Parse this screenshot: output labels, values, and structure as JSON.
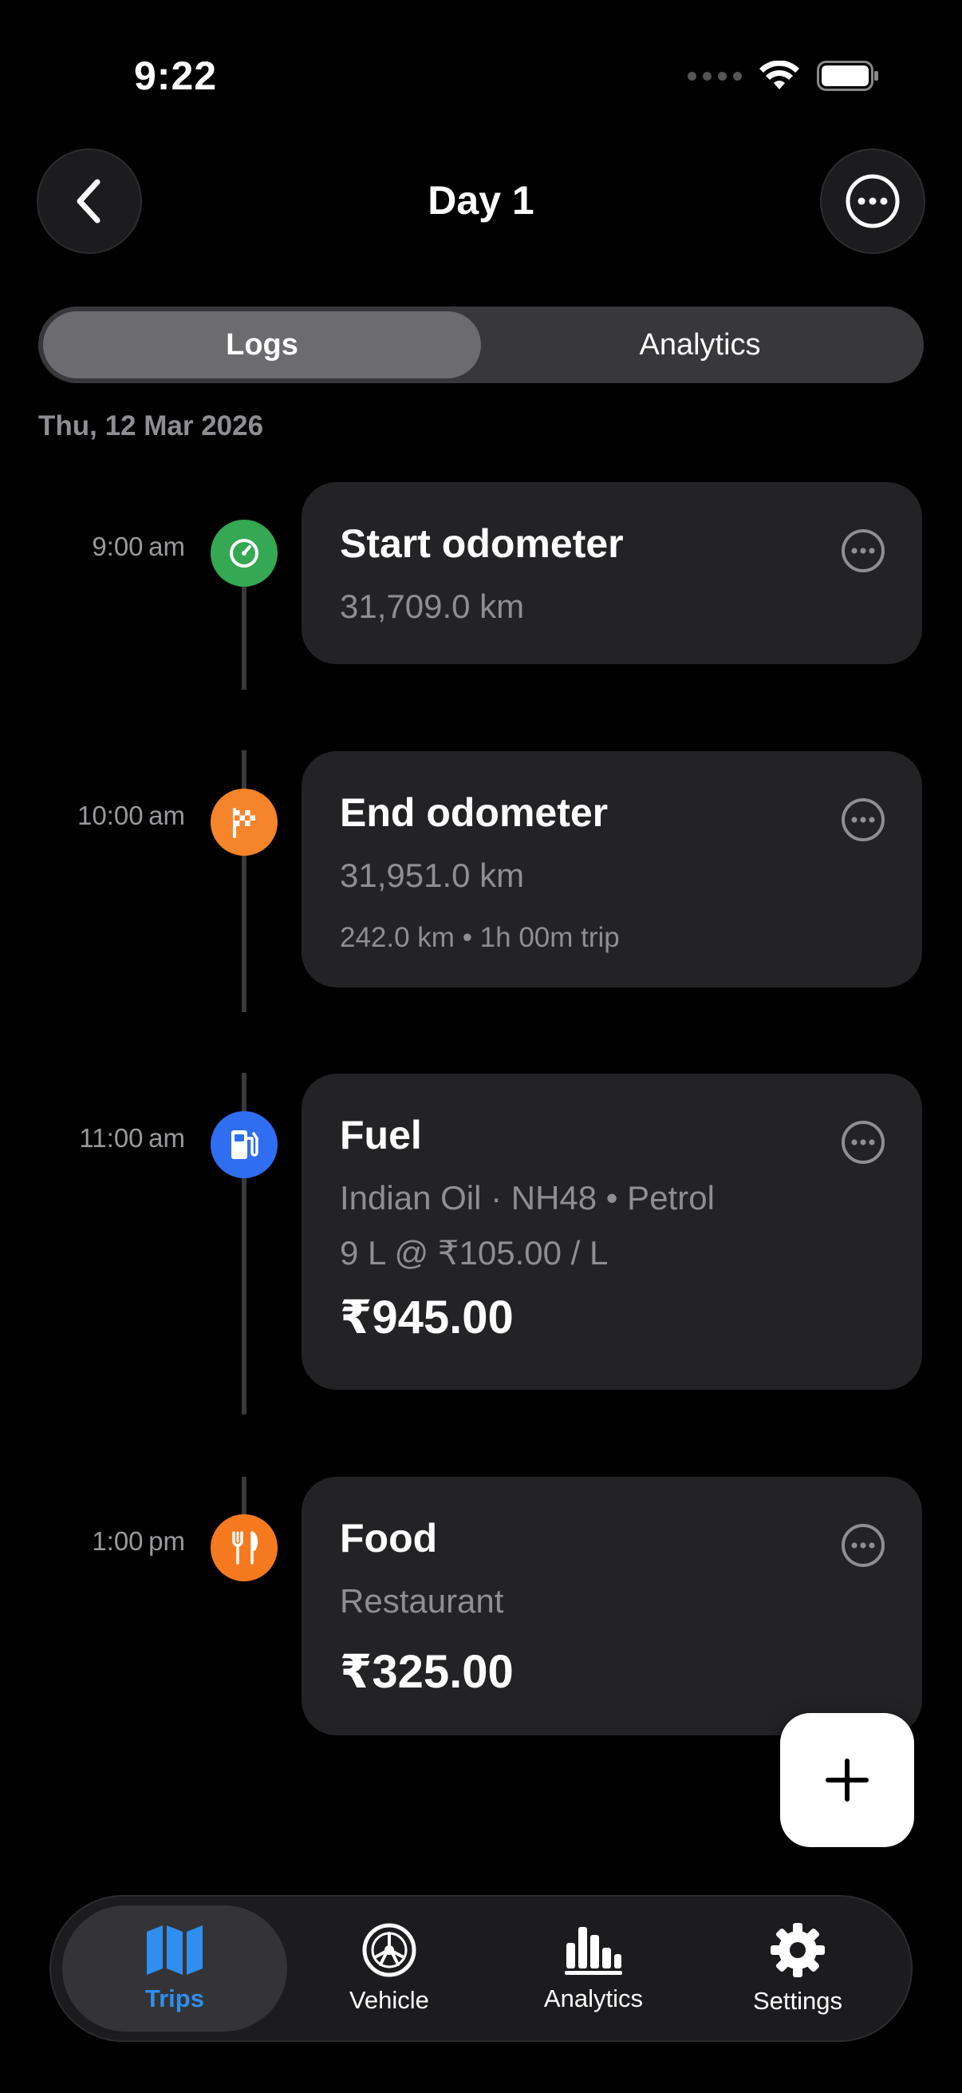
{
  "status": {
    "time": "9:22"
  },
  "header": {
    "title": "Day 1"
  },
  "segments": [
    {
      "label": "Logs",
      "active": true
    },
    {
      "label": "Analytics",
      "active": false
    }
  ],
  "date": "Thu, 12 Mar 2026",
  "entries": [
    {
      "time": "9:00 am",
      "icon": "speedometer-icon",
      "color": "#34a853",
      "title": "Start odometer",
      "reading": "31,709.0 km"
    },
    {
      "time": "10:00 am",
      "icon": "checkered-flag-icon",
      "color": "#f5842a",
      "title": "End odometer",
      "reading": "31,951.0 km",
      "detail": "242.0 km • 1h 00m trip"
    },
    {
      "time": "11:00 am",
      "icon": "fuel-pump-icon",
      "color": "#2f6ef0",
      "title": "Fuel",
      "line1": "Indian Oil · NH48 • Petrol",
      "line2": "9 L @ ₹105.00 / L",
      "amount": "₹945.00"
    },
    {
      "time": "1:00 pm",
      "icon": "fork-knife-icon",
      "color": "#f57a1f",
      "title": "Food",
      "line1": "Restaurant",
      "amount": "₹325.00"
    }
  ],
  "tabbar": [
    {
      "label": "Trips",
      "icon": "map-icon",
      "active": true,
      "color": "#2f8ff0"
    },
    {
      "label": "Vehicle",
      "icon": "wheel-icon",
      "active": false
    },
    {
      "label": "Analytics",
      "icon": "bar-chart-icon",
      "active": false
    },
    {
      "label": "Settings",
      "icon": "gear-icon",
      "active": false
    }
  ]
}
